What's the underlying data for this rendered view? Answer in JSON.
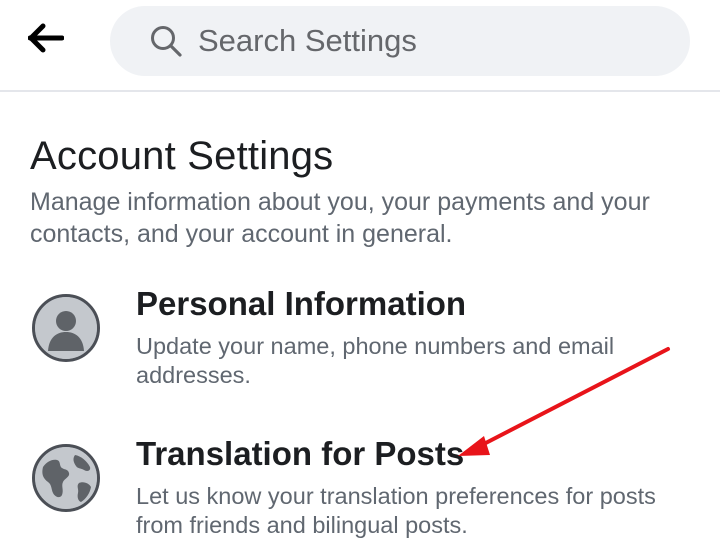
{
  "header": {
    "back_icon": "arrow-left-icon",
    "search": {
      "icon": "search-icon",
      "placeholder": "Search Settings",
      "value": ""
    }
  },
  "section": {
    "title": "Account Settings",
    "description": "Manage information about you, your payments and your contacts, and your account in general."
  },
  "items": [
    {
      "title": "Personal Information",
      "description": "Update your name, phone numbers and email addresses.",
      "icon": "person-icon"
    },
    {
      "title": "Translation for Posts",
      "description": "Let us know your translation preferences for posts from friends and bilingual posts.",
      "icon": "globe-icon"
    }
  ],
  "annotation": {
    "arrow_color": "#e8141a"
  },
  "colors": {
    "text_primary": "#1c1e21",
    "text_secondary": "#606770",
    "search_bg": "#f0f2f5"
  }
}
